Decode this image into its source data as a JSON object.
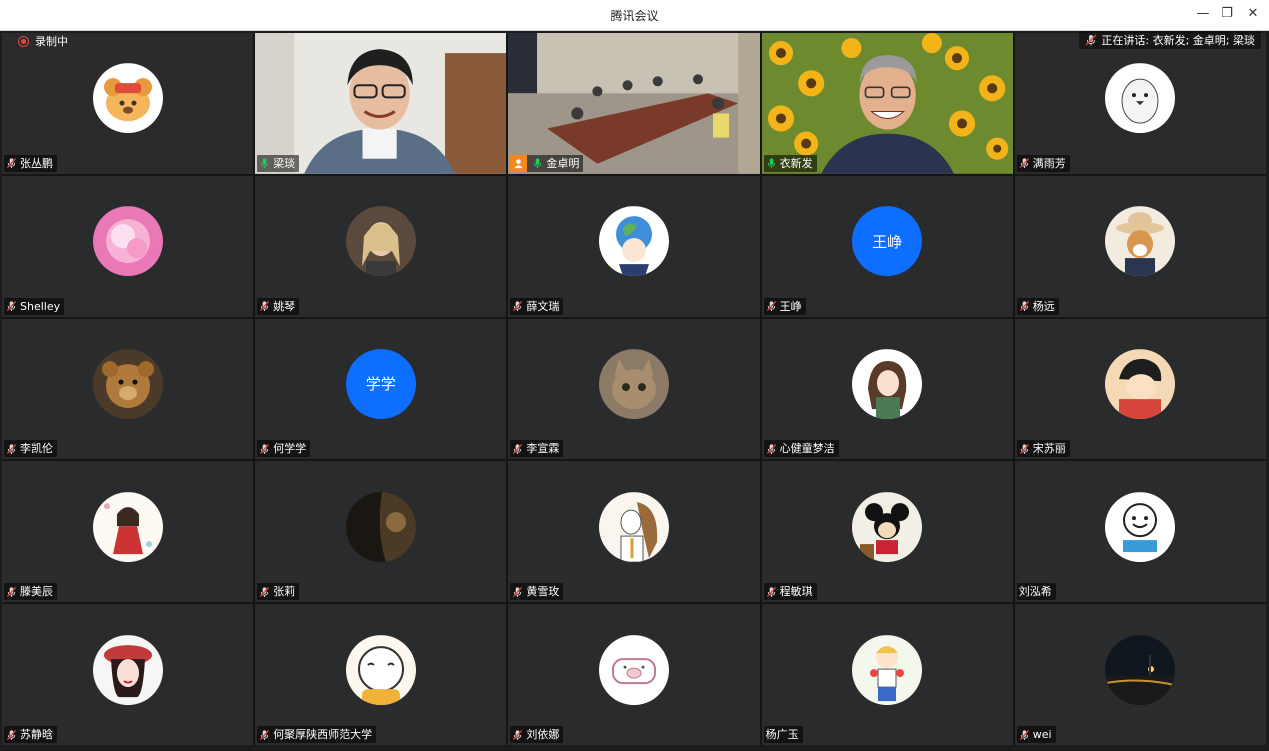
{
  "window": {
    "title": "腾讯会议",
    "min_icon": "minimize-icon",
    "max_icon": "restore-icon",
    "close_icon": "close-icon"
  },
  "recording": {
    "label": "录制中"
  },
  "speaking": {
    "label": "正在讲话: 衣新发; 金卓明; 梁琰"
  },
  "colors": {
    "avatar_blue": "#0e6eff",
    "tile_bg": "#2a2b2d",
    "host_badge": "#f28a1b",
    "speaking_green": "#1fce5a",
    "muted_red": "#e23d3d"
  },
  "participants": [
    {
      "name": "张丛鹏",
      "kind": "avatar",
      "mic": "muted",
      "avatar_desc": "dog-cartoon"
    },
    {
      "name": "梁琰",
      "kind": "video",
      "mic": "active",
      "avatar_desc": "man-glasses-video"
    },
    {
      "name": "金卓明",
      "kind": "video",
      "mic": "active",
      "host": true,
      "avatar_desc": "conference-room-video"
    },
    {
      "name": "衣新发",
      "kind": "video",
      "mic": "active",
      "avatar_desc": "sunflower-video"
    },
    {
      "name": "满雨芳",
      "kind": "avatar",
      "mic": "muted",
      "avatar_desc": "penguin-cartoon"
    },
    {
      "name": "Shelley",
      "kind": "avatar",
      "mic": "muted",
      "avatar_desc": "pink-flower"
    },
    {
      "name": "姚琴",
      "kind": "avatar",
      "mic": "muted",
      "avatar_desc": "girl-photo"
    },
    {
      "name": "薛文瑞",
      "kind": "avatar",
      "mic": "muted",
      "avatar_desc": "anime-earth-girl"
    },
    {
      "name": "王峥",
      "kind": "text",
      "mic": "muted",
      "avatar_text": "王峥"
    },
    {
      "name": "杨远",
      "kind": "avatar",
      "mic": "muted",
      "avatar_desc": "shiba-dog"
    },
    {
      "name": "李凯伦",
      "kind": "avatar",
      "mic": "muted",
      "avatar_desc": "teddy-bear"
    },
    {
      "name": "何学学",
      "kind": "text",
      "mic": "muted",
      "avatar_text": "学学"
    },
    {
      "name": "李宣霖",
      "kind": "avatar",
      "mic": "muted",
      "avatar_desc": "cat-photo"
    },
    {
      "name": "心健童梦洁",
      "kind": "avatar",
      "mic": "muted",
      "avatar_desc": "girl-illustration"
    },
    {
      "name": "宋苏丽",
      "kind": "avatar",
      "mic": "muted",
      "avatar_desc": "anime-boy"
    },
    {
      "name": "滕美辰",
      "kind": "avatar",
      "mic": "muted",
      "avatar_desc": "girl-red-dress"
    },
    {
      "name": "张莉",
      "kind": "avatar",
      "mic": "muted",
      "avatar_desc": "dark-photo"
    },
    {
      "name": "黄雪玫",
      "kind": "avatar",
      "mic": "muted",
      "avatar_desc": "girl-sketch"
    },
    {
      "name": "程敏琪",
      "kind": "avatar",
      "mic": "muted",
      "avatar_desc": "mickey-mouse"
    },
    {
      "name": "刘泓希",
      "kind": "avatar",
      "mic": "none",
      "avatar_desc": "smiley-reading"
    },
    {
      "name": "苏静晗",
      "kind": "avatar",
      "mic": "muted",
      "avatar_desc": "girl-red-hat"
    },
    {
      "name": "何聚厚陕西师范大学",
      "kind": "avatar",
      "mic": "muted",
      "avatar_desc": "cartoon-bun"
    },
    {
      "name": "刘依娜",
      "kind": "avatar",
      "mic": "muted",
      "avatar_desc": "pig-sketch"
    },
    {
      "name": "杨广玉",
      "kind": "avatar",
      "mic": "none",
      "avatar_desc": "boy-cartoon"
    },
    {
      "name": "wei",
      "kind": "avatar",
      "mic": "muted",
      "avatar_desc": "night-road"
    }
  ]
}
